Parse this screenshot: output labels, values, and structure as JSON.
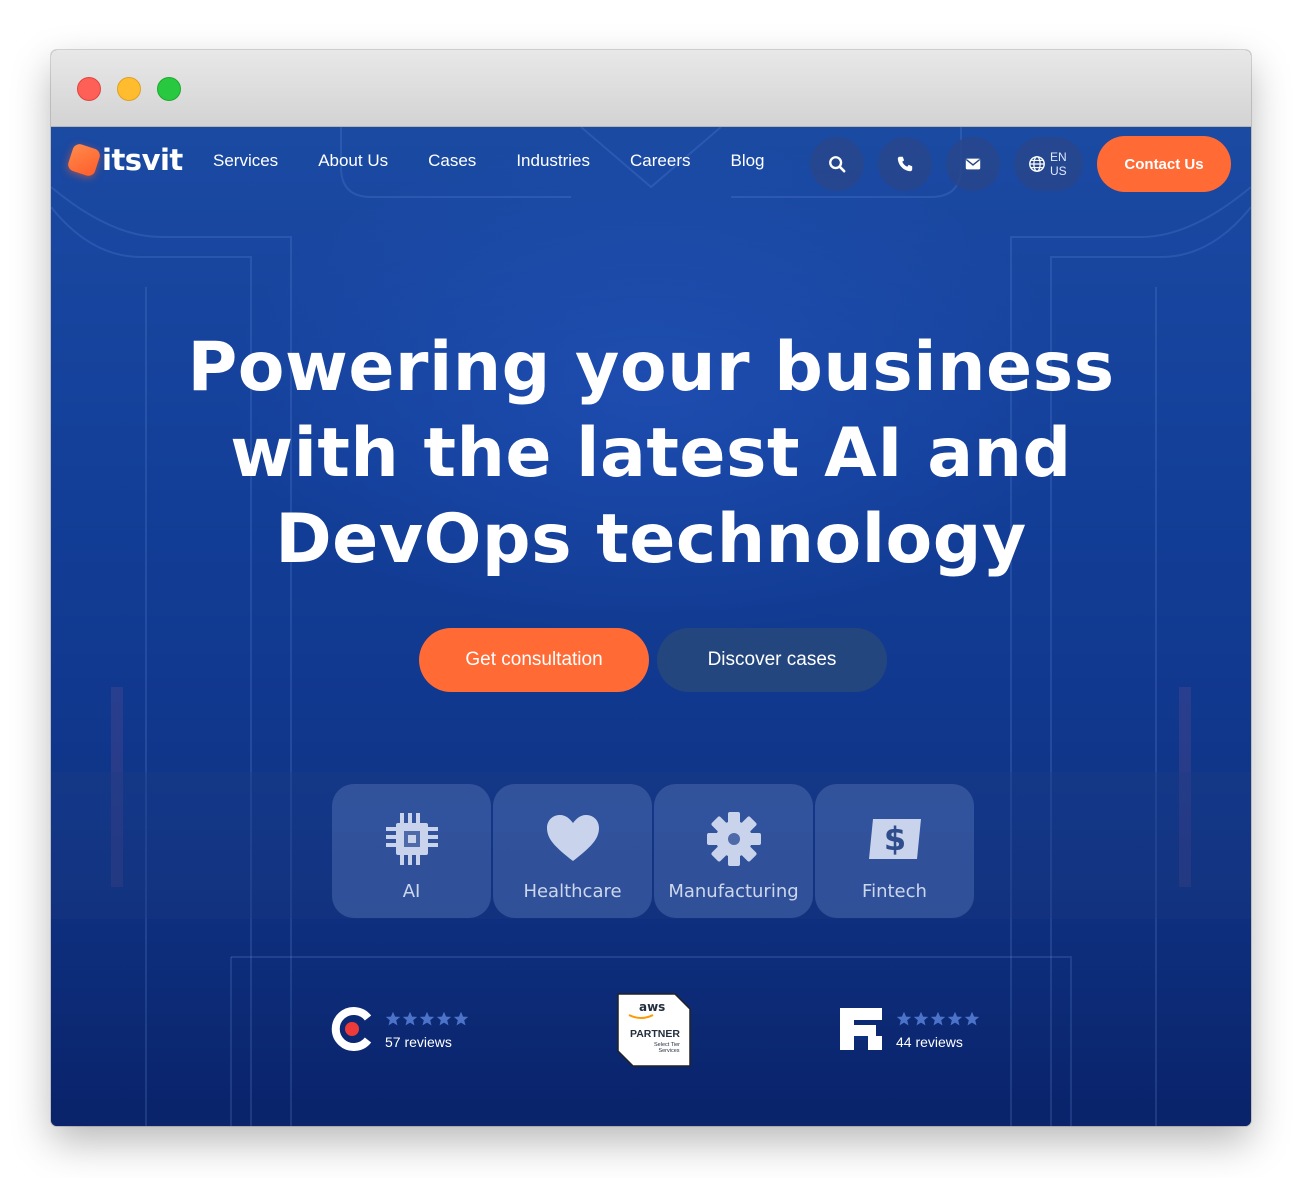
{
  "brand": {
    "name": "itsvit",
    "accent": "#ff6a35",
    "background": "#133f99"
  },
  "nav": {
    "items": [
      "Services",
      "About Us",
      "Cases",
      "Industries",
      "Careers",
      "Blog"
    ]
  },
  "header_actions": {
    "search_icon": "search-icon",
    "phone_icon": "phone-icon",
    "mail_icon": "mail-icon",
    "lang_line1": "EN",
    "lang_line2": "US",
    "contact_label": "Contact Us"
  },
  "hero": {
    "line1": "Powering your business",
    "line2": "with the latest AI and",
    "line3": "DevOps technology",
    "primary_cta": "Get consultation",
    "secondary_cta": "Discover cases"
  },
  "industries": [
    {
      "label": "AI",
      "icon": "chip-icon"
    },
    {
      "label": "Healthcare",
      "icon": "heart-icon"
    },
    {
      "label": "Manufacturing",
      "icon": "gear-icon"
    },
    {
      "label": "Fintech",
      "icon": "dollar-icon"
    }
  ],
  "ratings": {
    "clutch": {
      "reviews": "57 reviews",
      "stars": 5
    },
    "goodfirms": {
      "reviews": "44 reviews",
      "stars": 5
    },
    "aws": {
      "brand": "aws",
      "line1": "PARTNER",
      "line2": "Select Tier",
      "line3": "Services"
    }
  }
}
